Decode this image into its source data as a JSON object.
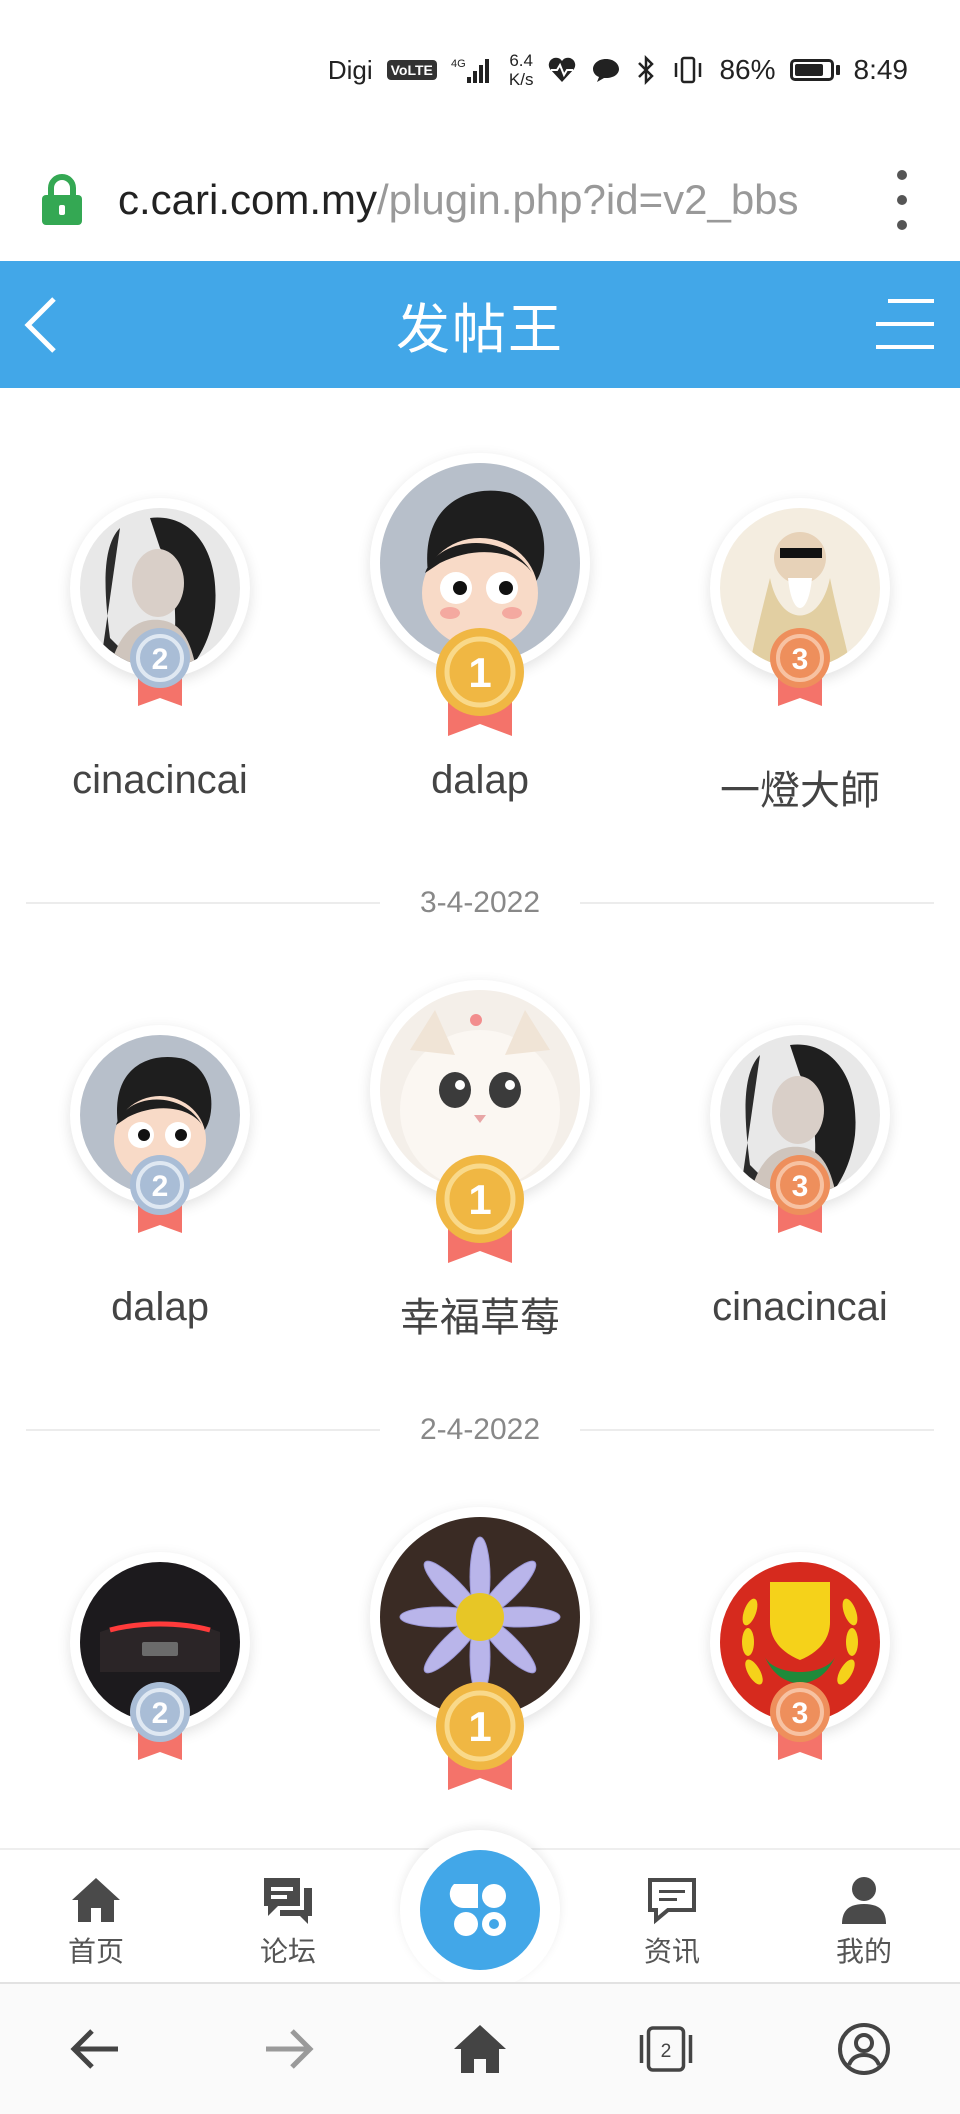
{
  "status_bar": {
    "carrier": "Digi",
    "volte": "VoLTE",
    "network": "4G",
    "speed_value": "6.4",
    "speed_unit": "K/s",
    "battery": "86%",
    "time": "8:49",
    "battery_level": 0.86
  },
  "browser": {
    "url_host": "c.cari.com.my",
    "url_path": "/plugin.php?id=v2_bbs"
  },
  "header": {
    "title": "发帖王"
  },
  "colors": {
    "header_bg": "#42a7e8",
    "gold": "#f0b743",
    "silver": "#a9bdd6",
    "bronze": "#ee8f5c",
    "ribbon": "#f4736a"
  },
  "rankings": [
    {
      "first": {
        "name": "dalap",
        "rank": "1"
      },
      "second": {
        "name": "cinacincai",
        "rank": "2"
      },
      "third": {
        "name": "一燈大師",
        "rank": "3"
      },
      "date": "3-4-2022"
    },
    {
      "first": {
        "name": "幸福草莓",
        "rank": "1"
      },
      "second": {
        "name": "dalap",
        "rank": "2"
      },
      "third": {
        "name": "cinacincai",
        "rank": "3"
      },
      "date": "2-4-2022"
    },
    {
      "first": {
        "name": "",
        "rank": "1"
      },
      "second": {
        "name": "",
        "rank": "2"
      },
      "third": {
        "name": "",
        "rank": "3"
      }
    }
  ],
  "bottom_nav": {
    "home": "首页",
    "forum": "论坛",
    "news": "资讯",
    "mine": "我的"
  },
  "browser_bar": {
    "tab_count": "2"
  }
}
